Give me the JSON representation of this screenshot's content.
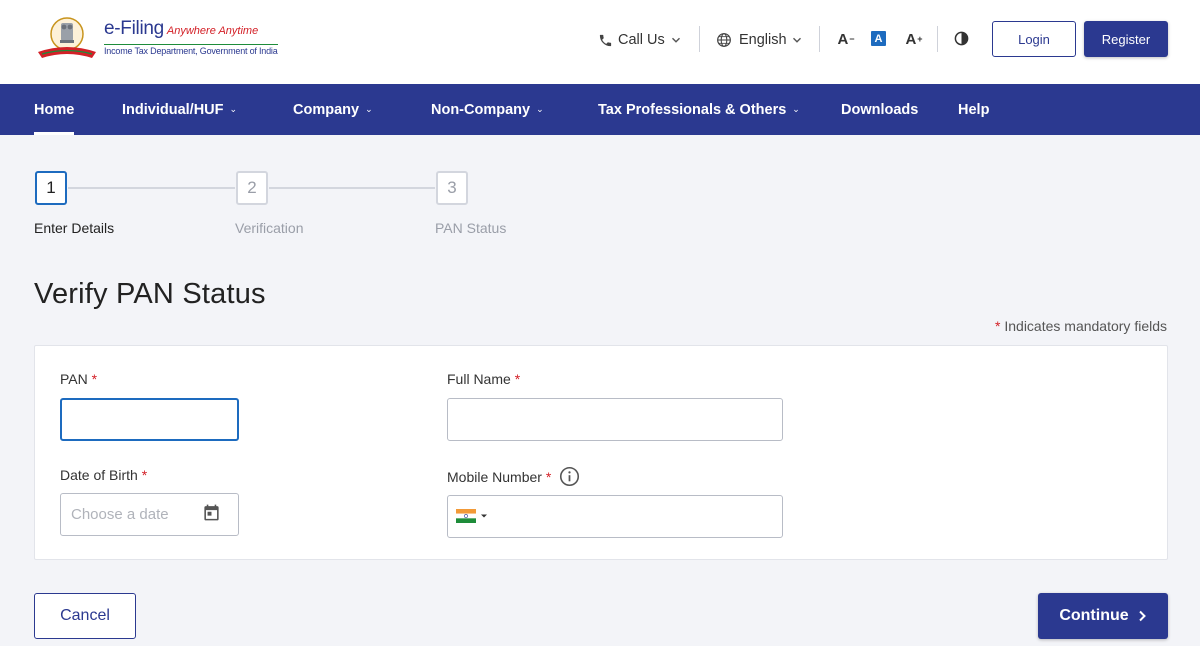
{
  "header": {
    "brand_main": "e-Filing",
    "brand_tagline": "Anywhere Anytime",
    "brand_sub": "Income Tax Department, Government of India",
    "call_us_label": "Call Us",
    "language_label": "English",
    "font_decrease_label": "A",
    "font_default_label": "A",
    "font_increase_label": "A",
    "login_label": "Login",
    "register_label": "Register",
    "icons": [
      "emblem-logo",
      "phone-icon",
      "globe-icon",
      "chevron-down-icon",
      "contrast-icon"
    ]
  },
  "nav": {
    "items": [
      {
        "label": "Home",
        "has_caret": false,
        "active": true
      },
      {
        "label": "Individual/HUF",
        "has_caret": true
      },
      {
        "label": "Company",
        "has_caret": true
      },
      {
        "label": "Non-Company",
        "has_caret": true
      },
      {
        "label": "Tax Professionals & Others",
        "has_caret": true
      },
      {
        "label": "Downloads",
        "has_caret": false
      },
      {
        "label": "Help",
        "has_caret": false
      }
    ]
  },
  "stepper": {
    "steps": [
      {
        "number": "1",
        "label": "Enter Details",
        "active": true
      },
      {
        "number": "2",
        "label": "Verification",
        "active": false
      },
      {
        "number": "3",
        "label": "PAN Status",
        "active": false
      }
    ]
  },
  "page": {
    "title": "Verify PAN Status",
    "mandatory_star": "*",
    "mandatory_note": "Indicates mandatory fields"
  },
  "form": {
    "pan": {
      "label": "PAN",
      "required": "*",
      "value": ""
    },
    "full_name": {
      "label": "Full Name",
      "required": "*",
      "value": ""
    },
    "dob": {
      "label": "Date of Birth",
      "required": "*",
      "placeholder": "Choose a date",
      "value": ""
    },
    "mobile": {
      "label": "Mobile Number",
      "required": "*",
      "value": "",
      "country": "India"
    }
  },
  "actions": {
    "cancel_label": "Cancel",
    "continue_label": "Continue"
  },
  "colors": {
    "primary": "#2b3990",
    "focus": "#1d6bbf",
    "required": "#d32027",
    "background": "#f3f4f8"
  }
}
